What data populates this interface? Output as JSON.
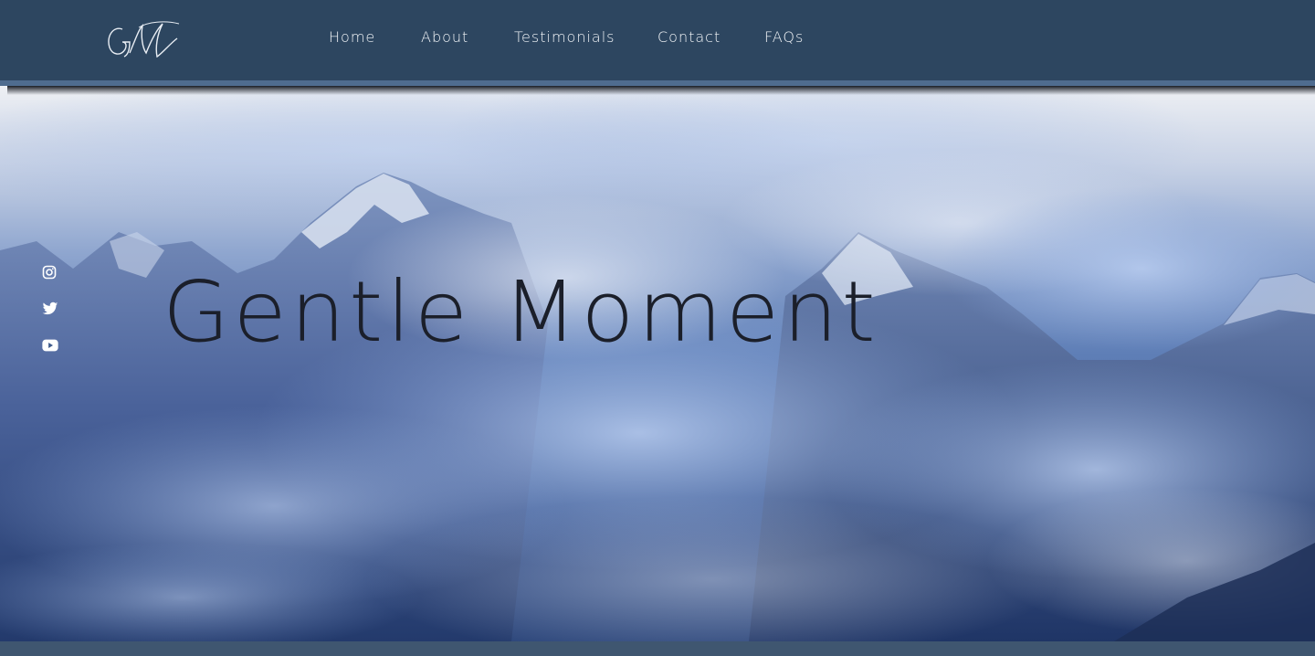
{
  "brand": {
    "logo_text": "GM",
    "logo_icon": "script-monogram-logo"
  },
  "nav": {
    "items": [
      {
        "label": "Home"
      },
      {
        "label": "About"
      },
      {
        "label": "Testimonials"
      },
      {
        "label": "Contact"
      },
      {
        "label": "FAQs"
      }
    ]
  },
  "hero": {
    "title": "Gentle Moment",
    "background": "snowy-mountains-clouds-photo"
  },
  "social": [
    {
      "icon": "instagram-icon"
    },
    {
      "icon": "twitter-icon"
    },
    {
      "icon": "youtube-icon"
    }
  ],
  "colors": {
    "header_bg": "#2d4660",
    "header_stripe": "#4f6c8f",
    "nav_text": "#f2f5f8",
    "title_text": "#1b1f2a",
    "footer_bar": "#3f5670"
  }
}
